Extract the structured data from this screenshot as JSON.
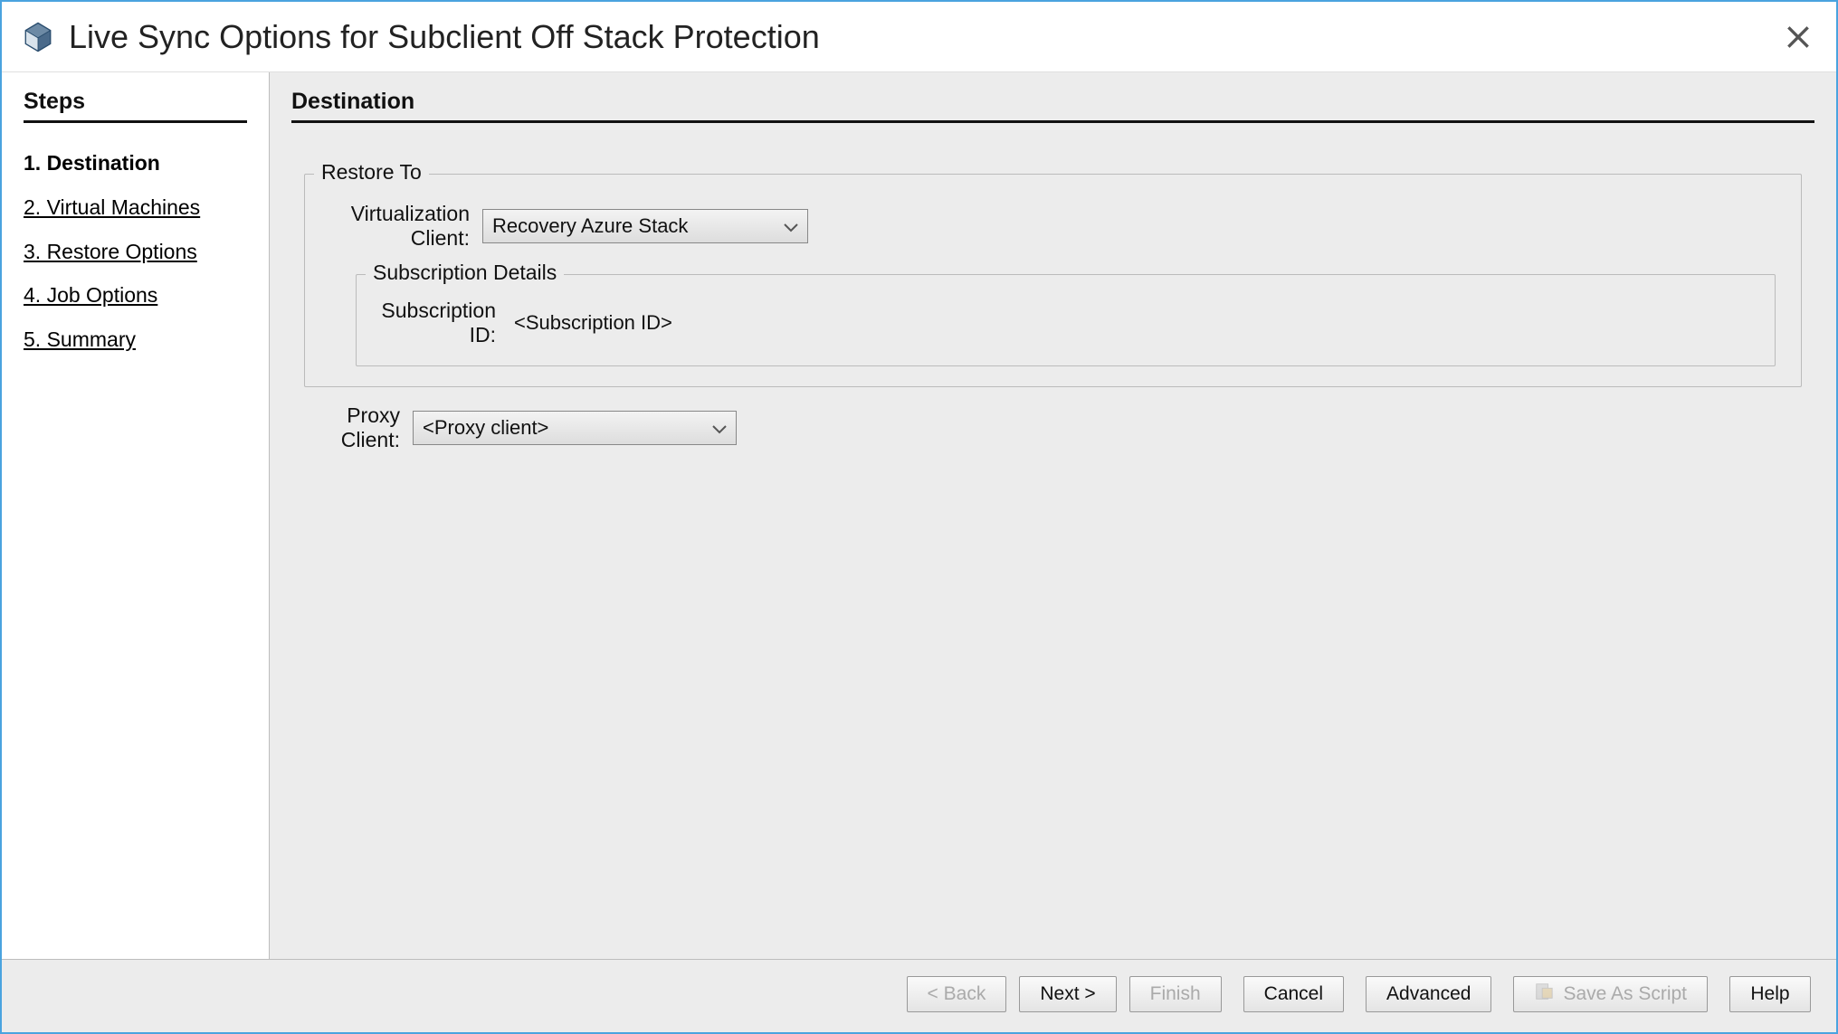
{
  "window": {
    "title": "Live Sync Options for Subclient Off Stack Protection"
  },
  "sidebar": {
    "title": "Steps",
    "items": [
      {
        "label": "1. Destination",
        "current": true
      },
      {
        "label": "2. Virtual Machines",
        "current": false
      },
      {
        "label": "3. Restore Options",
        "current": false
      },
      {
        "label": "4. Job Options",
        "current": false
      },
      {
        "label": "5. Summary",
        "current": false
      }
    ]
  },
  "main": {
    "title": "Destination",
    "restoreTo": {
      "legend": "Restore To",
      "virtClientLabel": "Virtualization Client:",
      "virtClientValue": "Recovery Azure Stack",
      "subscription": {
        "legend": "Subscription Details",
        "idLabel": "Subscription ID:",
        "idValue": "<Subscription ID>"
      }
    },
    "proxy": {
      "label": "Proxy Client:",
      "value": "<Proxy client>"
    }
  },
  "footer": {
    "back": "< Back",
    "next": "Next >",
    "finish": "Finish",
    "cancel": "Cancel",
    "advanced": "Advanced",
    "saveScript": "Save As Script",
    "help": "Help"
  }
}
